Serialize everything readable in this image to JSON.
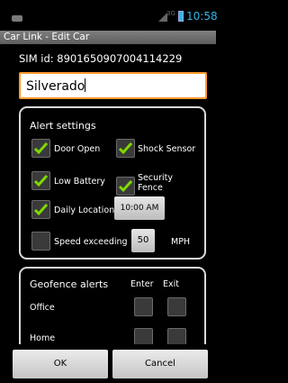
{
  "status_bar": {
    "time": "10:58",
    "signal_label": "3G"
  },
  "title_bar": {
    "title": "Car Link - Edit Car"
  },
  "sim": {
    "label": "SIM id:",
    "value": "8901650907004114229",
    "text": "SIM id:  8901650907004114229"
  },
  "car_name": {
    "value": "Silverado"
  },
  "alert_settings": {
    "title": "Alert settings",
    "items": [
      {
        "label": "Door Open",
        "checked": true
      },
      {
        "label": "Shock Sensor",
        "checked": true
      },
      {
        "label": "Low Battery",
        "checked": true
      },
      {
        "label": "Security Fence",
        "checked": true
      },
      {
        "label": "Daily Location",
        "checked": true,
        "time": "10:00 AM"
      },
      {
        "label": "Speed exceeding",
        "checked": false,
        "speed": "50",
        "unit": "MPH"
      }
    ]
  },
  "geofence": {
    "title": "Geofence alerts",
    "columns": {
      "enter": "Enter",
      "exit": "Exit"
    },
    "rows": [
      {
        "label": "Office",
        "enter": false,
        "exit": false
      },
      {
        "label": "Home",
        "enter": false,
        "exit": false
      }
    ]
  },
  "buttons": {
    "ok": "OK",
    "cancel": "Cancel"
  },
  "colors": {
    "accent": "#ff9a2e",
    "check": "#7fd900",
    "status_blue": "#33b5e5"
  }
}
